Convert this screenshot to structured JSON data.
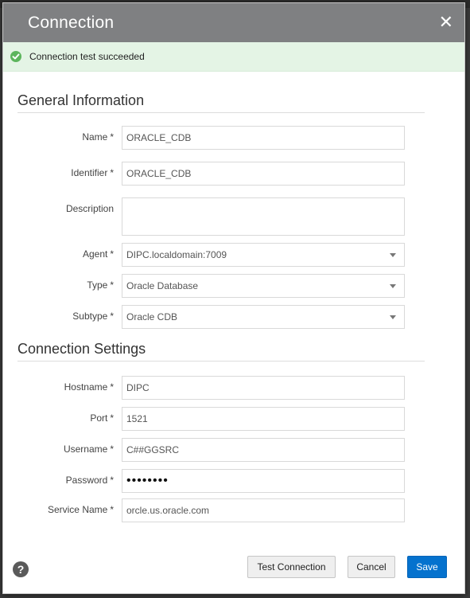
{
  "dialog": {
    "title": "Connection",
    "close_glyph": "✕"
  },
  "banner": {
    "message": "Connection test succeeded",
    "icon": "check-circle-icon",
    "color": "#5db55d"
  },
  "general": {
    "title": "General Information",
    "fields": {
      "name": {
        "label": "Name",
        "required": "*",
        "value": "ORACLE_CDB"
      },
      "identifier": {
        "label": "Identifier",
        "required": "*",
        "value": "ORACLE_CDB"
      },
      "description": {
        "label": "Description",
        "value": ""
      },
      "agent": {
        "label": "Agent",
        "required": "*",
        "value": "DIPC.localdomain:7009"
      },
      "type": {
        "label": "Type",
        "required": "*",
        "value": "Oracle Database"
      },
      "subtype": {
        "label": "Subtype",
        "required": "*",
        "value": "Oracle CDB"
      }
    }
  },
  "settings": {
    "title": "Connection Settings",
    "fields": {
      "hostname": {
        "label": "Hostname",
        "required": "*",
        "value": "DIPC"
      },
      "port": {
        "label": "Port",
        "required": "*",
        "value": "1521"
      },
      "username": {
        "label": "Username",
        "required": "*",
        "value": "C##GGSRC"
      },
      "password": {
        "label": "Password",
        "required": "*",
        "value": "••••••••"
      },
      "service_name": {
        "label": "Service Name",
        "required": "*",
        "value": "orcle.us.oracle.com"
      }
    }
  },
  "footer": {
    "help_glyph": "?",
    "test_label": "Test Connection",
    "cancel_label": "Cancel",
    "save_label": "Save",
    "accent_color": "#0572ce"
  }
}
